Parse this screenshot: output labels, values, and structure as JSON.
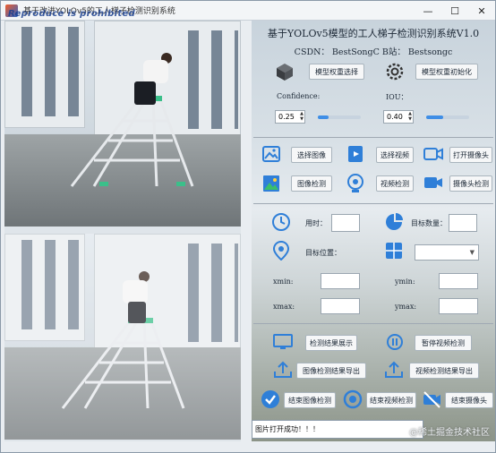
{
  "window": {
    "title": "基于改进YOLOv5的工人梯子检测识别系统",
    "overlay_text": "Reproduce is prohibited",
    "controls": {
      "minimize": "—",
      "maximize": "☐",
      "close": "✕"
    }
  },
  "panel": {
    "title": "基于YOLOv5模型的工人梯子检测识别系统V1.0",
    "csdn": "CSDN：  BestSongC    B站：  Bestsongc",
    "buttons": {
      "model_select": "模型权重选择",
      "model_init": "模型权重初始化",
      "select_image": "选择图像",
      "select_video": "选择视频",
      "open_camera": "打开摄像头",
      "image_detect": "图像检测",
      "video_detect": "视频检测",
      "camera_detect": "摄像头检测",
      "show_results": "检测结果展示",
      "pause_video": "暂停视频检测",
      "export_image_results": "图像检测结果导出",
      "export_video_results": "视频检测结果导出",
      "stop_image": "结束图像检测",
      "stop_video": "结束视频检测",
      "stop_camera": "结束摄像头"
    },
    "labels": {
      "confidence": "Confidence:",
      "iou": "IOU：",
      "time_used": "用时：",
      "target_count": "目标数量：",
      "target_position": "目标位置：",
      "xmin": "xmin:",
      "ymin": "ymin:",
      "xmax": "xmax:",
      "ymax": "ymax:"
    },
    "confidence_value": "0.25",
    "iou_value": "0.40",
    "confidence_slider": 0.25,
    "iou_slider": 0.4
  },
  "status_text": "图片打开成功！！！",
  "corner_watermark": "@稀土掘金技术社区",
  "colors": {
    "accent_blue": "#2f7fd8",
    "slider_fill": "#3f8ee6"
  }
}
